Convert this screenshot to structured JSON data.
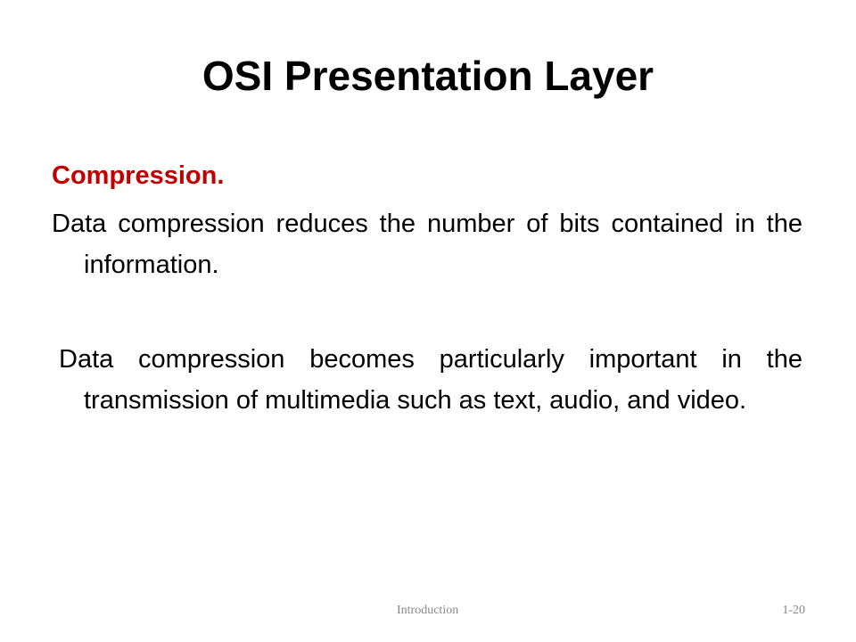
{
  "slide": {
    "title": "OSI Presentation Layer",
    "section_heading": "Compression.",
    "paragraphs": [
      "Data compression reduces the number of bits contained in the information.",
      "Data compression becomes particularly important in the transmission of multimedia such as text, audio, and video."
    ],
    "footer": {
      "center_text": "Introduction",
      "slide_number": "1-20"
    }
  },
  "colors": {
    "title": "#000000",
    "section_heading": "#c00000",
    "body_text": "#000000",
    "footer_text": "#888888",
    "background": "#ffffff"
  }
}
